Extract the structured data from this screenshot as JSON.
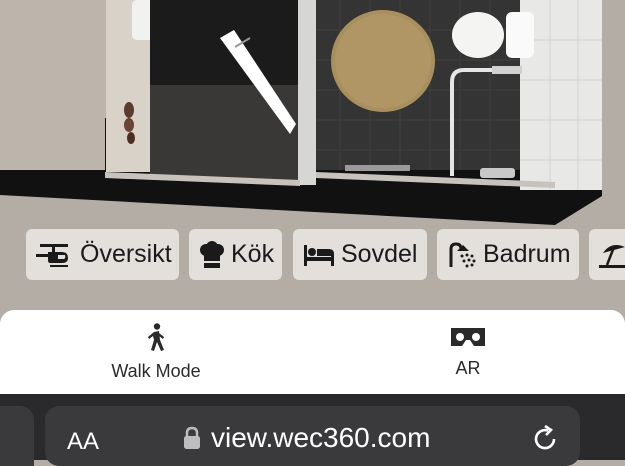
{
  "rooms": [
    {
      "label": "Översikt",
      "icon": "helicopter-icon"
    },
    {
      "label": "Kök",
      "icon": "chef-hat-icon"
    },
    {
      "label": "Sovdel",
      "icon": "bed-icon"
    },
    {
      "label": "Badrum",
      "icon": "shower-icon"
    },
    {
      "label": "",
      "icon": "beach-umbrella-icon"
    }
  ],
  "modes": {
    "walk": {
      "label": "Walk Mode",
      "icon": "walking-person-icon"
    },
    "ar": {
      "label": "AR",
      "icon": "vr-headset-icon"
    }
  },
  "browser": {
    "text_size_label": "AA",
    "url": "view.wec360.com",
    "secure_icon": "lock-icon",
    "reload_icon": "reload-icon"
  },
  "colors": {
    "chip_bg": "#e3e0dc",
    "scene_bg": "#b3ada5",
    "browser_bg": "#2a2a2c",
    "rug": "#a88f5c"
  }
}
